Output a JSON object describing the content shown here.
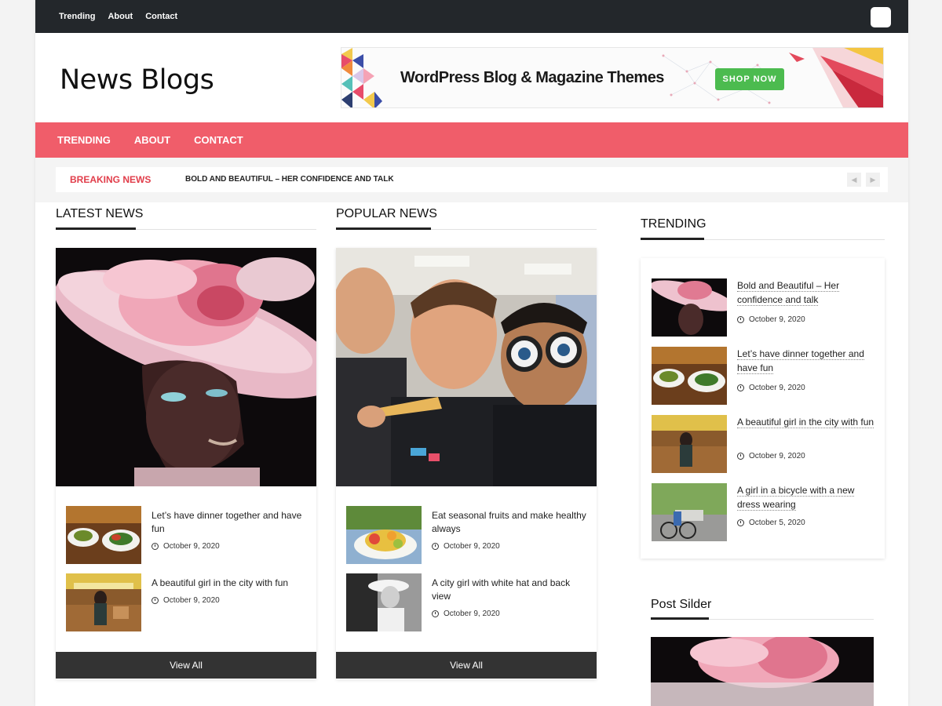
{
  "topbar": {
    "links": [
      "Trending",
      "About",
      "Contact"
    ]
  },
  "header": {
    "site_title": "News Blogs",
    "banner": {
      "headline": "WordPress Blog & Magazine Themes",
      "cta": "SHOP NOW"
    }
  },
  "main_nav": {
    "items": [
      "TRENDING",
      "ABOUT",
      "CONTACT"
    ]
  },
  "breaking": {
    "label": "BREAKING NEWS",
    "headline": "BOLD AND BEAUTIFUL – HER CONFIDENCE AND TALK"
  },
  "latest": {
    "title": "LATEST NEWS",
    "items": [
      {
        "title": "Let’s have dinner together and have fun",
        "date": "October 9, 2020"
      },
      {
        "title": "A beautiful girl in the city with fun",
        "date": "October 9, 2020"
      }
    ],
    "view_all": "View All"
  },
  "popular": {
    "title": "POPULAR NEWS",
    "items": [
      {
        "title": "Eat seasonal fruits and make healthy always",
        "date": "October 9, 2020"
      },
      {
        "title": "A city girl with white hat and back view",
        "date": "October 9, 2020"
      }
    ],
    "view_all": "View All"
  },
  "trending": {
    "title": "TRENDING",
    "items": [
      {
        "title": "Bold and Beautiful – Her confidence and talk",
        "date": "October 9, 2020"
      },
      {
        "title": "Let’s have dinner together and have fun",
        "date": "October 9, 2020"
      },
      {
        "title": "A beautiful girl in the city with fun",
        "date": "October 9, 2020"
      },
      {
        "title": "A girl in a bicycle with a new dress wearing",
        "date": "October 5, 2020"
      }
    ]
  },
  "post_slider": {
    "title": "Post Silder"
  },
  "colors": {
    "accent": "#f05d6a",
    "breaking": "#e13d4a",
    "dark": "#23272b",
    "button": "#333333",
    "shop": "#4cbb4f"
  },
  "icons": {
    "search": "search-icon",
    "clock": "clock-icon",
    "prev": "chevron-left-icon",
    "next": "chevron-right-icon"
  }
}
